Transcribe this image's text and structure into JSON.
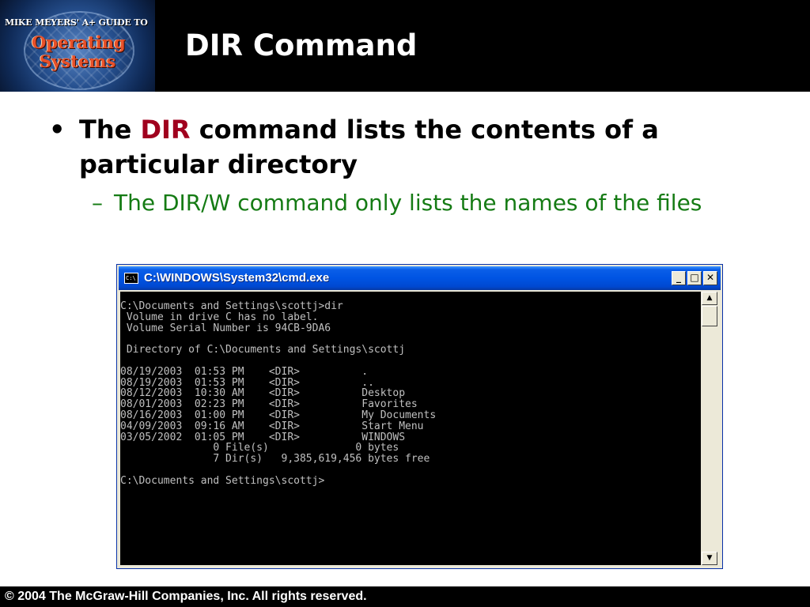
{
  "logo": {
    "line1": "MIKE MEYERS' A+ GUIDE TO",
    "line2": "Operating",
    "line3": "Systems"
  },
  "slide_title": "DIR Command",
  "bullet1": {
    "prefix": "The ",
    "highlight": "DIR",
    "suffix": " command lists the contents of a particular directory"
  },
  "bullet2": {
    "text": "The DIR/W command only lists the names of the files"
  },
  "window": {
    "title": "C:\\WINDOWS\\System32\\cmd.exe",
    "icon_text": "C:\\"
  },
  "console_text": "C:\\Documents and Settings\\scottj>dir\n Volume in drive C has no label.\n Volume Serial Number is 94CB-9DA6\n\n Directory of C:\\Documents and Settings\\scottj\n\n08/19/2003  01:53 PM    <DIR>          .\n08/19/2003  01:53 PM    <DIR>          ..\n08/12/2003  10:30 AM    <DIR>          Desktop\n08/01/2003  02:23 PM    <DIR>          Favorites\n08/16/2003  01:00 PM    <DIR>          My Documents\n04/09/2003  09:16 AM    <DIR>          Start Menu\n03/05/2002  01:05 PM    <DIR>          WINDOWS\n               0 File(s)              0 bytes\n               7 Dir(s)   9,385,619,456 bytes free\n\nC:\\Documents and Settings\\scottj>",
  "footer": "© 2004 The McGraw-Hill Companies, Inc. All rights reserved.",
  "colors": {
    "highlight": "#a0001e",
    "subbullet": "#157b14",
    "titlebar": "#0054e3",
    "console_bg": "#000000",
    "console_fg": "#c0c0c0"
  }
}
